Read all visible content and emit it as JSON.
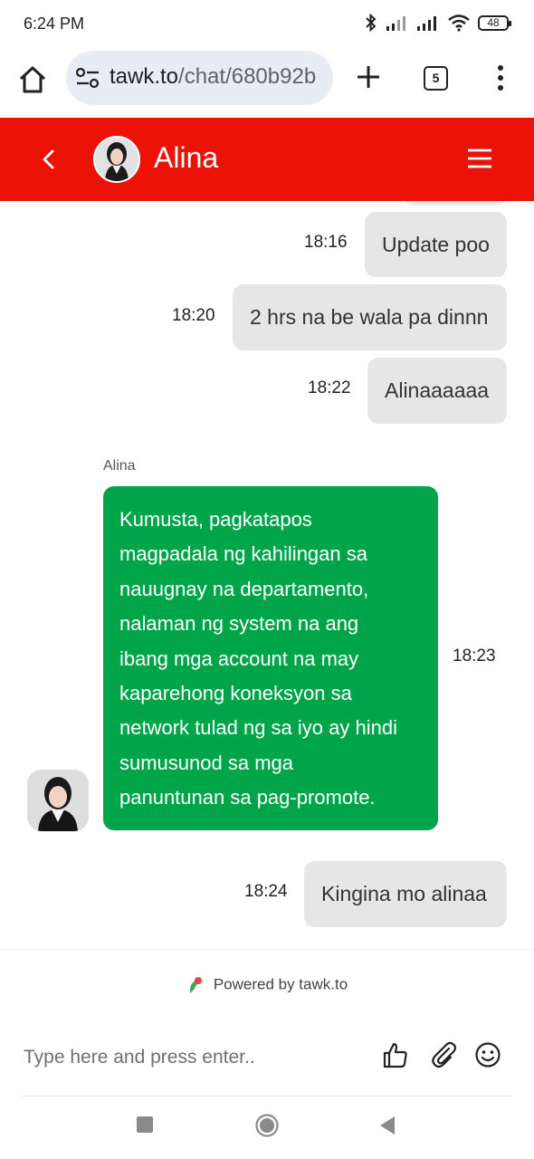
{
  "status": {
    "time": "6:24 PM",
    "battery": "48"
  },
  "browser": {
    "url_host": "tawk.to",
    "url_path": "/chat/680b92b",
    "tab_count": "5"
  },
  "header": {
    "title": "Alina"
  },
  "messages": {
    "m1": {
      "time": "18:16",
      "text": "Update poo"
    },
    "m2": {
      "time": "18:20",
      "text": "2 hrs na be wala pa dinnn"
    },
    "m3": {
      "time": "18:22",
      "text": "Alinaaaaaa"
    },
    "agent": {
      "name": "Alina",
      "time": "18:23",
      "lines": [
        "Kumusta, pagkatapos",
        "magpadala ng kahilingan sa",
        "nauugnay na departamento,",
        "nalaman ng system na ang",
        "ibang mga account na may",
        "kaparehong koneksyon sa",
        "network tulad ng sa iyo ay hindi",
        "sumusunod sa mga",
        "panuntunan sa pag-promote."
      ]
    },
    "m4": {
      "time": "18:24",
      "text": "Kingina mo alinaa"
    }
  },
  "footer": {
    "powered_by": "Powered by tawk.to",
    "input_placeholder": "Type here and press enter.."
  },
  "colors": {
    "header": "#ec1208",
    "agent_bubble": "#00a54a",
    "visitor_bubble": "#e6e6e6"
  }
}
